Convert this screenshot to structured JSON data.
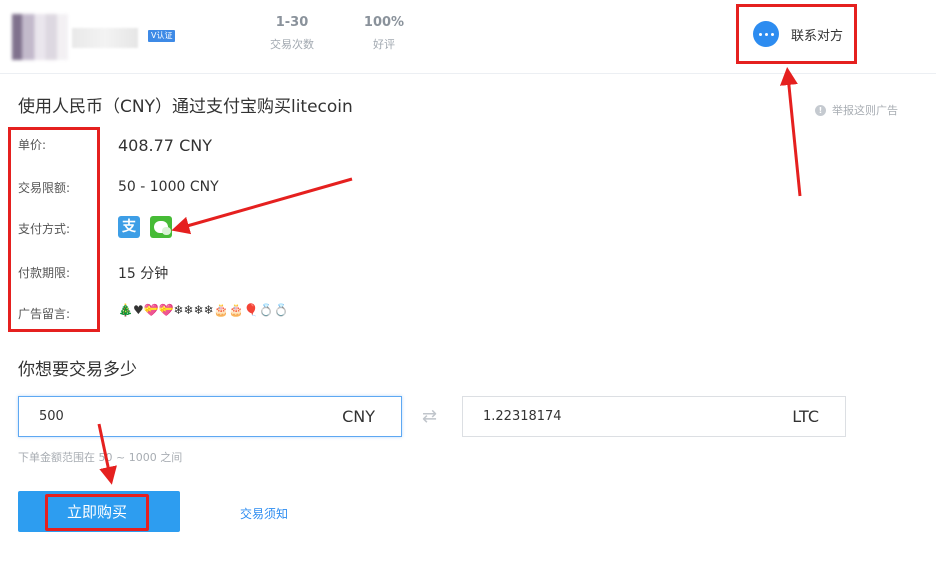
{
  "header": {
    "verified_badge": "V认证",
    "stats": [
      {
        "value": "1-30",
        "label": "交易次数"
      },
      {
        "value": "100%",
        "label": "好评"
      }
    ],
    "contact_label": "联系对方"
  },
  "main": {
    "title": "使用人民币（CNY）通过支付宝购买litecoin",
    "report_label": "举报这则广告",
    "fields": [
      {
        "label": "单价:",
        "value": "408.77 CNY"
      },
      {
        "label": "交易限额:",
        "value": "50 - 1000 CNY"
      },
      {
        "label": "支付方式:",
        "icons": [
          "alipay-icon",
          "wechat-pay-icon"
        ]
      },
      {
        "label": "付款期限:",
        "value": "15 分钟"
      },
      {
        "label": "广告留言:",
        "value": "🎄♥💝💝❄❄❄❄🎂🎂🎈💍💍"
      }
    ],
    "alipay_glyph": "支"
  },
  "trade": {
    "section_title": "你想要交易多少",
    "cny_value": "500",
    "cny_unit": "CNY",
    "swap_glyph": "⇄",
    "ltc_value": "1.22318174",
    "ltc_unit": "LTC",
    "hint": "下单金额范围在 50 ~ 1000 之间",
    "buy_label": "立即购买",
    "notice_label": "交易须知"
  },
  "colors": {
    "accent": "#2d9df0",
    "annotation_red": "#e5201f",
    "alipay": "#3d9ee6",
    "wechat": "#46bb36"
  }
}
